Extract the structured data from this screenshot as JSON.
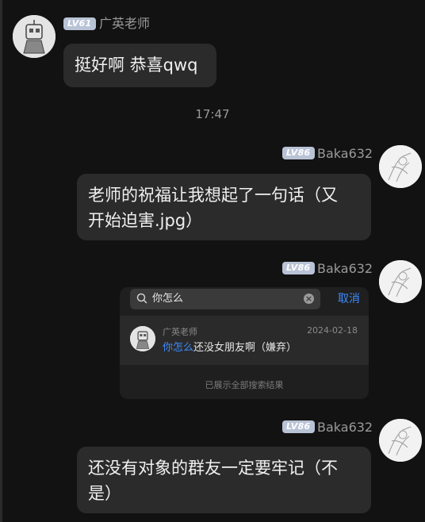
{
  "messages": {
    "m1": {
      "level": "LV61",
      "sender": "广英老师",
      "text": "挺好啊 恭喜qwq"
    },
    "timestamp": "17:47",
    "m2": {
      "level": "LV86",
      "sender": "Baka632",
      "line1": "老师的祝福让我想起了一句话（又",
      "line2": "开始迫害.jpg）"
    },
    "m3": {
      "level": "LV86",
      "sender": "Baka632",
      "search": {
        "query": "你怎么",
        "cancel_label": "取消",
        "result": {
          "sender": "广英老师",
          "date": "2024-02-18",
          "highlight": "你怎么",
          "rest": "还没女朋友啊（嫌弃）"
        },
        "footer": "已展示全部搜索结果"
      }
    },
    "m4": {
      "level": "LV86",
      "sender": "Baka632",
      "line1": "还没有对象的群友一定要牢记（不",
      "line2": "是）"
    }
  },
  "icons": {
    "search": "search-icon",
    "clear": "clear-icon",
    "avatar_robot": "robot-avatar",
    "avatar_sketch": "sketch-avatar"
  }
}
